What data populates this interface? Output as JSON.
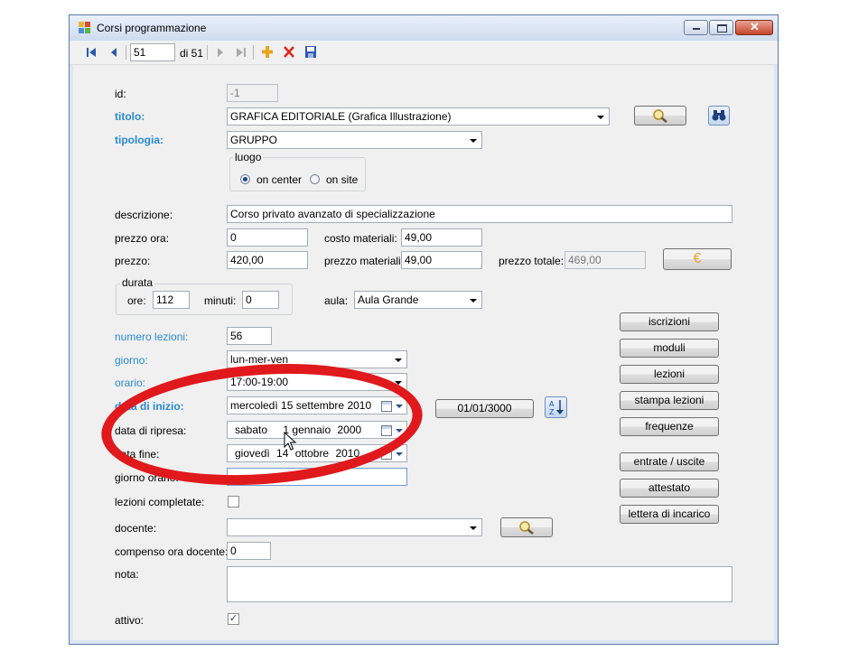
{
  "window": {
    "title": "Corsi programmazione"
  },
  "navigator": {
    "position": "51",
    "of": "di 51"
  },
  "form": {
    "id": {
      "label": "id:",
      "value": "-1"
    },
    "titolo": {
      "label": "titolo:",
      "value": "GRAFICA EDITORIALE (Grafica Illustrazione)"
    },
    "tipologia": {
      "label": "tipologia:",
      "value": "GRUPPO"
    },
    "luogo": {
      "label": "luogo",
      "option1": "on center",
      "option2": "on site",
      "selected": "on center"
    },
    "descrizione": {
      "label": "descrizione:",
      "value": "Corso privato avanzato di specializzazione"
    },
    "prezzo_ora": {
      "label": "prezzo ora:",
      "value": "0"
    },
    "costo_materiali": {
      "label": "costo materiali:",
      "value": "49,00"
    },
    "prezzo": {
      "label": "prezzo:",
      "value": "420,00"
    },
    "prezzo_materiali": {
      "label": "prezzo materiali:",
      "value": "49,00"
    },
    "prezzo_totale": {
      "label": "prezzo totale:",
      "value": "469,00"
    },
    "euro_symbol": "€",
    "durata": {
      "label": "durata",
      "ore_label": "ore:",
      "ore": "112",
      "minuti_label": "minuti:",
      "minuti": "0"
    },
    "aula": {
      "label": "aula:",
      "value": "Aula Grande"
    },
    "numero_lezioni": {
      "label": "numero lezioni:",
      "value": "56"
    },
    "giorno": {
      "label": "giorno:",
      "value": "lun-mer-ven"
    },
    "orario": {
      "label": "orario:",
      "value": "17:00-19:00"
    },
    "data_inizio": {
      "label": "data di inizio:",
      "weekday": "mercoledì",
      "day": "15",
      "month": "settembre",
      "year": "2010"
    },
    "data_ripresa": {
      "label": "data di ripresa:",
      "weekday": "sabato",
      "day": "1",
      "month": "gennaio",
      "year": "2000"
    },
    "data_fine": {
      "label": "data fine:",
      "weekday": "giovedì",
      "day": "14",
      "month": "ottobre",
      "year": "2010"
    },
    "date_button": "01/01/3000",
    "giorno_orario": {
      "label": "giorno orario:",
      "value": ""
    },
    "lezioni_completate": {
      "label": "lezioni completate:",
      "checked": false
    },
    "docente": {
      "label": "docente:",
      "value": ""
    },
    "compenso": {
      "label": "compenso ora docente:",
      "value": "0"
    },
    "nota": {
      "label": "nota:",
      "value": ""
    },
    "attivo": {
      "label": "attivo:",
      "checked": true
    }
  },
  "buttons": {
    "iscrizioni": "iscrizioni",
    "moduli": "moduli",
    "lezioni": "lezioni",
    "stampa_lezioni": "stampa lezioni",
    "frequenze": "frequenze",
    "entrate_uscite": "entrate / uscite",
    "attestato": "attestato",
    "lettera_incarico": "lettera di incarico"
  },
  "annotation": {
    "color": "#e0191c"
  }
}
